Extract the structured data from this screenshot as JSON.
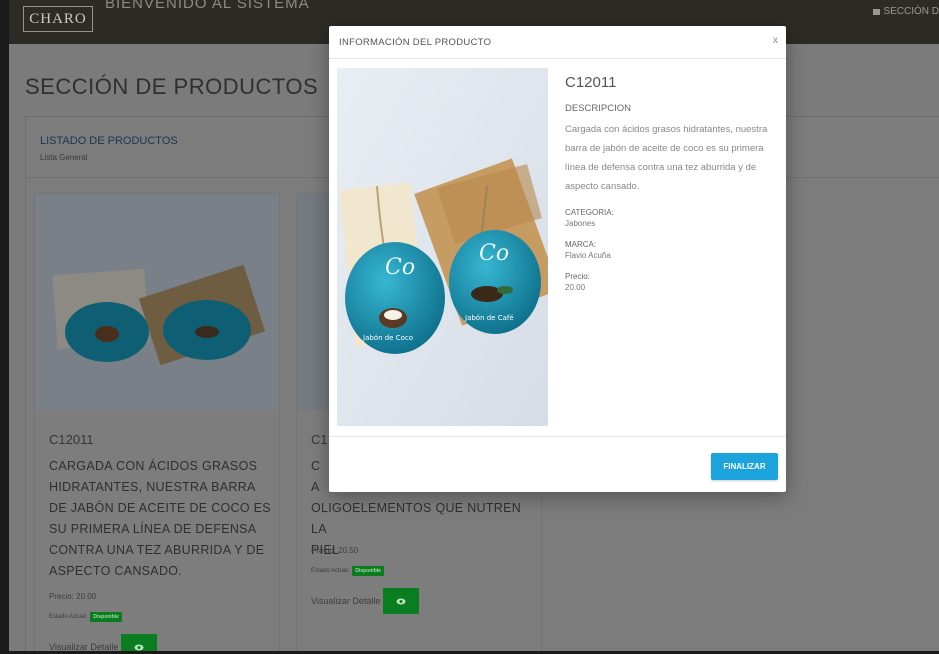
{
  "header": {
    "logo": "CHARO",
    "welcome": "BIENVENIDO AL SISTEMA",
    "section_link": "SECCIÓN D"
  },
  "page": {
    "title": "SECCIÓN DE PRODUCTOS",
    "list_title": "LISTADO DE PRODUCTOS",
    "list_subtitle": "Lista General"
  },
  "products": [
    {
      "code": "C12011",
      "description": "CARGADA CON ÁCIDOS GRASOS HIDRATANTES, NUESTRA BARRA DE JABÓN DE ACEITE DE COCO ES SU PRIMERA LÍNEA DE DEFENSA CONTRA UNA TEZ ABURRIDA Y DE ASPECTO CANSADO.",
      "price_label": "Precio: 20.00",
      "status_label": "Estado Actual:",
      "status_badge": "Disponible",
      "detail_label": "Visualizar Detalle"
    },
    {
      "code": "C1",
      "description_lines": [
        "C",
        "A",
        "OLIGOELEMENTOS QUE NUTREN LA",
        "PIEL"
      ],
      "price_label": "Precio: 20.50",
      "status_label": "Estado Actual:",
      "status_badge": "Disponible",
      "detail_label": "Visualizar Detalle"
    }
  ],
  "modal": {
    "title": "INFORMACIÓN DEL PRODUCTO",
    "close": "x",
    "code": "C12011",
    "description_label": "DESCRIPCION",
    "description": "Cargada con ácidos grasos hidratantes, nuestra barra de jabón de aceite de coco es su primera línea de defensa contra una tez aburrida y de aspecto cansado.",
    "category_label": "CATEGORIA:",
    "category": "Jabones",
    "brand_label": "MARCA:",
    "brand": "Flavio Acuña",
    "price_label": "Precio:",
    "price": "20.00",
    "finish_button": "FINALIZAR",
    "soap_labels": {
      "coco_brand": "Co",
      "coco": "Jabón de Coco",
      "cafe_brand": "Co",
      "cafe": "Jabón de Café"
    }
  },
  "colors": {
    "accent": "#1aa3dc",
    "success": "#0c7a1e",
    "header_bg": "#2e2a25"
  }
}
